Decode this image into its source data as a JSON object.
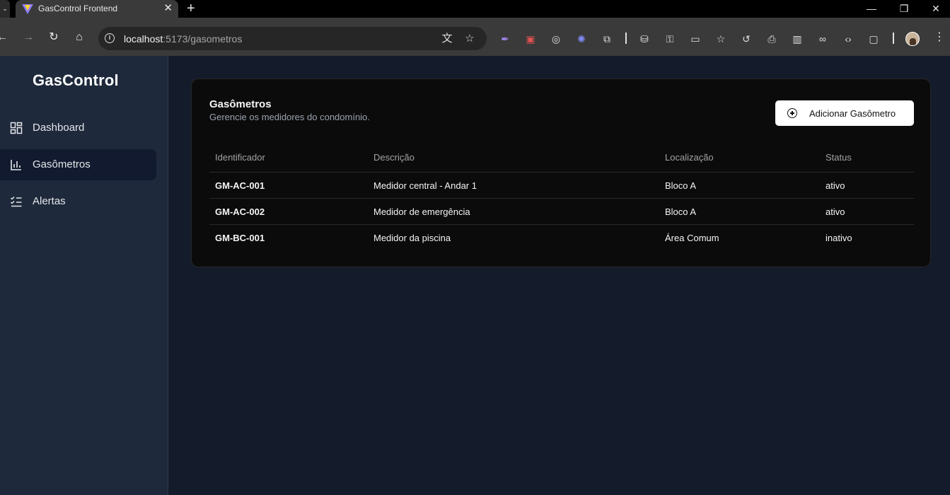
{
  "browser": {
    "tab_title": "GasControl Frontend",
    "new_tab_symbol": "+",
    "url_host": "localhost",
    "url_path": ":5173/gasometros"
  },
  "sidebar": {
    "brand": "GasControl",
    "items": [
      {
        "label": "Dashboard",
        "icon": "dashboard-grid-icon",
        "active": false
      },
      {
        "label": "Gasômetros",
        "icon": "bar-chart-icon",
        "active": true
      },
      {
        "label": "Alertas",
        "icon": "checklist-icon",
        "active": false
      }
    ]
  },
  "page": {
    "title": "Gasômetros",
    "subtitle": "Gerencie os medidores do condomínio.",
    "add_button_label": "Adicionar Gasômetro"
  },
  "table": {
    "columns": [
      "Identificador",
      "Descrição",
      "Localização",
      "Status"
    ],
    "rows": [
      {
        "id": "GM-AC-001",
        "descricao": "Medidor central - Andar 1",
        "localizacao": "Bloco A",
        "status": "ativo"
      },
      {
        "id": "GM-AC-002",
        "descricao": "Medidor de emergência",
        "localizacao": "Bloco A",
        "status": "ativo"
      },
      {
        "id": "GM-BC-001",
        "descricao": "Medidor da piscina",
        "localizacao": "Área Comum",
        "status": "inativo"
      }
    ]
  },
  "colors": {
    "sidebar_bg": "#1e293b",
    "main_bg": "#141b2b",
    "card_bg": "#0b0b0b",
    "button_bg": "#ffffff"
  }
}
